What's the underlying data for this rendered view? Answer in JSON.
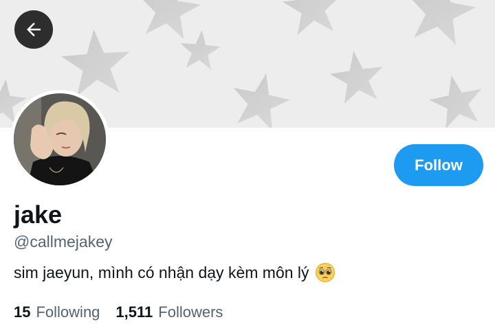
{
  "profile": {
    "display_name": "jake",
    "handle": "@callmejakey",
    "bio": "sim jaeyun, mình có nhận dạy kèm môn lý",
    "bio_emoji": "pleading-face-emoji"
  },
  "actions": {
    "follow_label": "Follow",
    "back_icon": "arrow-left-icon"
  },
  "stats": {
    "following_count": "15",
    "following_label": "Following",
    "followers_count": "1,511",
    "followers_label": "Followers"
  },
  "colors": {
    "accent": "#1d9bf0",
    "text_primary": "#0f1419",
    "text_secondary": "#536471",
    "banner_bg": "#ededed",
    "star_color": "#c4c4c4"
  }
}
